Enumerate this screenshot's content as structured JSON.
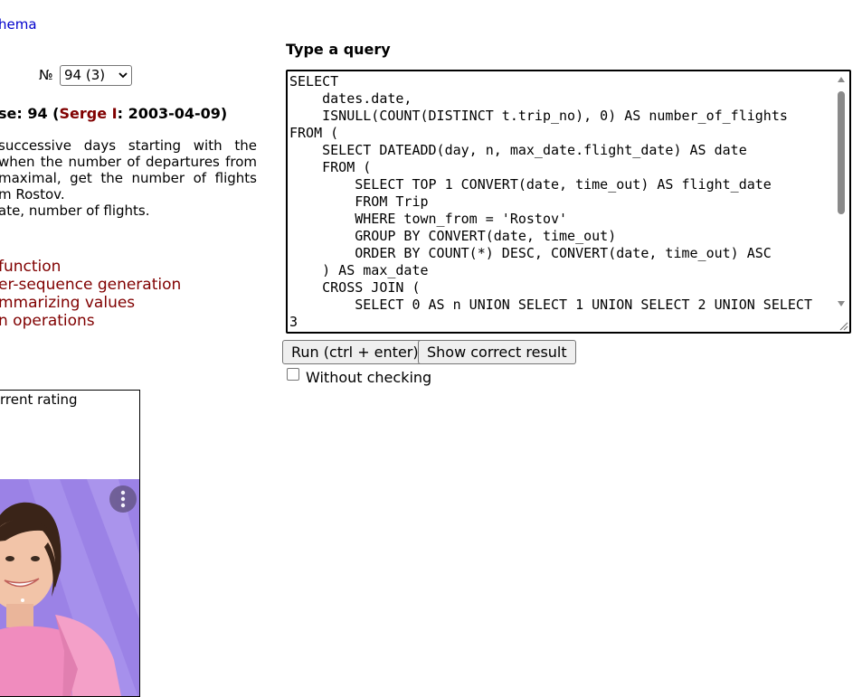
{
  "left": {
    "schema_link": "hema",
    "number_label": "№",
    "number_select_value": "94 (3)",
    "exercise": {
      "prefix": "se: 94 (",
      "author": "Serge I",
      "suffix": ": 2003-04-09)"
    },
    "description_lines": [
      "successive days starting with the",
      " when the number of departures from",
      " maximal, get the number of flights",
      "m Rostov.",
      "ate, number of flights."
    ],
    "topics": [
      "function",
      "er-sequence generation",
      "mmarizing values",
      "n operations"
    ],
    "rating_label": "rrent rating"
  },
  "query": {
    "label": "Type a query",
    "code": "SELECT\n    dates.date,\n    ISNULL(COUNT(DISTINCT t.trip_no), 0) AS number_of_flights\nFROM (\n    SELECT DATEADD(day, n, max_date.flight_date) AS date\n    FROM (\n        SELECT TOP 1 CONVERT(date, time_out) AS flight_date\n        FROM Trip\n        WHERE town_from = 'Rostov'\n        GROUP BY CONVERT(date, time_out)\n        ORDER BY COUNT(*) DESC, CONVERT(date, time_out) ASC\n    ) AS max_date\n    CROSS JOIN (\n        SELECT 0 AS n UNION SELECT 1 UNION SELECT 2 UNION SELECT\n3"
  },
  "buttons": {
    "run": "Run (ctrl + enter)",
    "show_correct": "Show correct result"
  },
  "without_checking_label": "Without checking",
  "colors": {
    "link": "#0000cc",
    "topic": "#800000",
    "ad_background": "#9b82e6"
  }
}
